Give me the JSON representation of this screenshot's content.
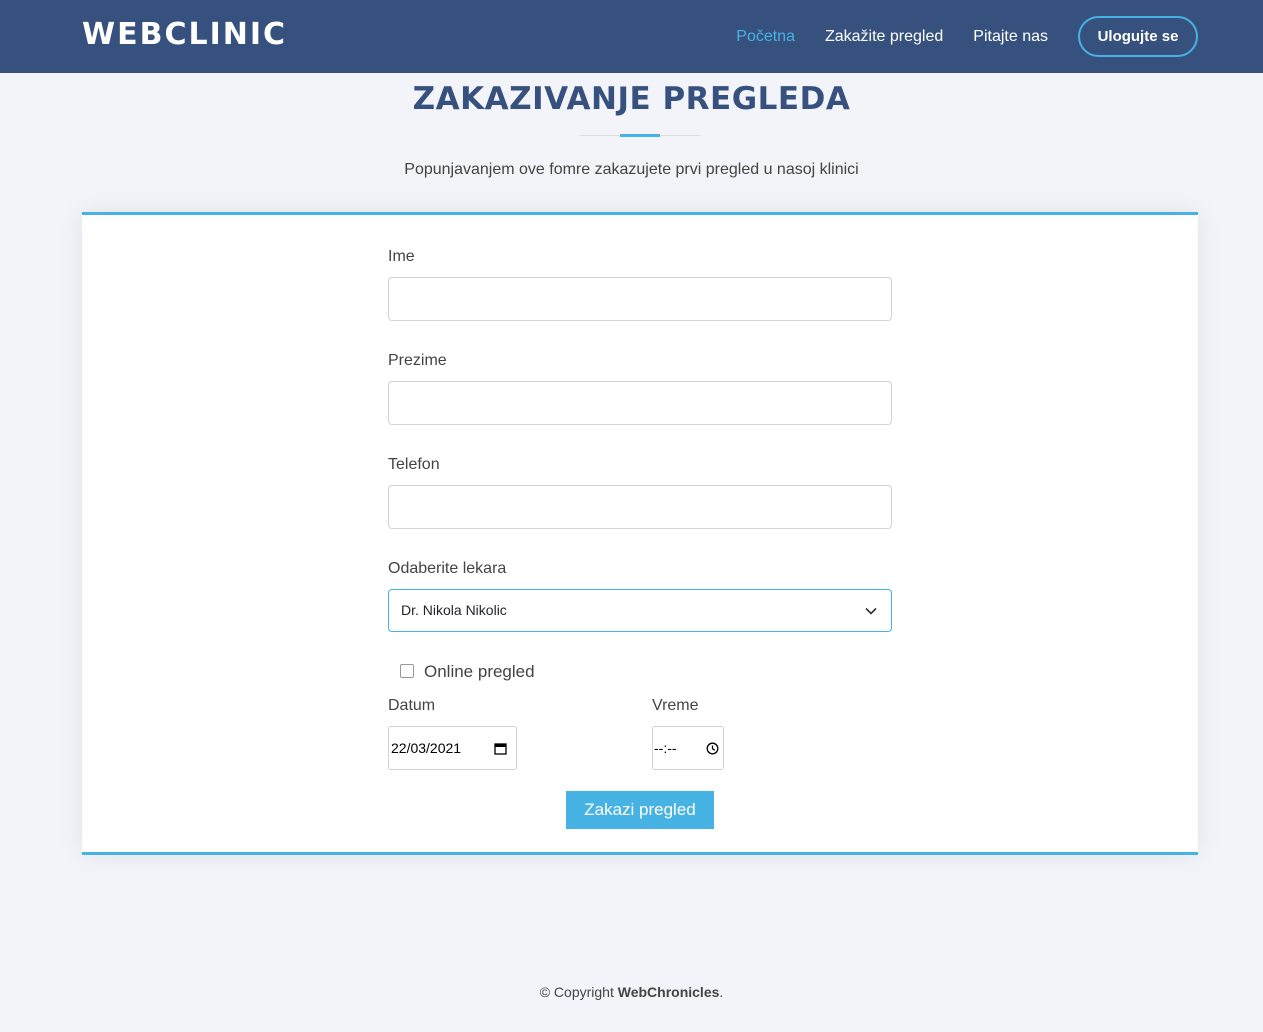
{
  "header": {
    "logo": "WEBCLINIC",
    "nav": [
      {
        "label": "Početna",
        "active": true
      },
      {
        "label": "Zakažite pregled",
        "active": false
      },
      {
        "label": "Pitajte nas",
        "active": false
      }
    ],
    "login_label": "Ulogujte se"
  },
  "section": {
    "title": "ZAKAZIVANJE PREGLEDA",
    "subtitle": "Popunjavanjem ove fomre zakazujete prvi pregled u nasoj klinici"
  },
  "form": {
    "first_name_label": "Ime",
    "first_name_value": "",
    "last_name_label": "Prezime",
    "last_name_value": "",
    "phone_label": "Telefon",
    "phone_value": "",
    "doctor_label": "Odaberite lekara",
    "doctor_selected": "Dr. Nikola Nikolic",
    "online_label": "Online pregled",
    "online_checked": false,
    "date_label": "Datum",
    "date_value": "22/03/2021",
    "time_label": "Vreme",
    "time_value": "--:--",
    "submit_label": "Zakazi pregled"
  },
  "footer": {
    "prefix": "© Copyright ",
    "brand": "WebChronicles",
    "suffix": "."
  },
  "colors": {
    "header_bg": "#37517e",
    "accent": "#47b2e4",
    "page_bg": "#f3f4f9"
  },
  "icons": {
    "select_arrow": "chevron-down-icon",
    "date_picker": "calendar-icon",
    "time_picker": "clock-icon"
  }
}
